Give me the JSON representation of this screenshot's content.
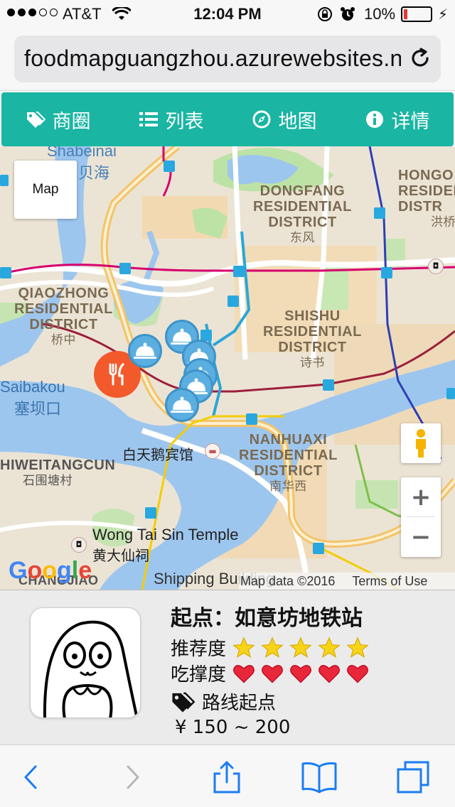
{
  "status": {
    "carrier": "AT&T",
    "time": "12:04 PM",
    "battery": "10%"
  },
  "browser": {
    "url": "foodmapguangzhou.azurewebsites.net"
  },
  "nav": {
    "items": [
      {
        "label": "商圈",
        "icon": "tags-icon"
      },
      {
        "label": "列表",
        "icon": "list-icon"
      },
      {
        "label": "地图",
        "icon": "compass-icon"
      },
      {
        "label": "详情",
        "icon": "info-icon"
      }
    ]
  },
  "map": {
    "type_button": "Map",
    "districts": [
      {
        "name": "DONGFANG\nRESIDENTIAL\nDISTRICT",
        "en1": "DONGFANG",
        "en2": "RESIDENTIAL",
        "en3": "DISTRICT",
        "zh": "东风"
      },
      {
        "en1": "QIAOZHONG",
        "en2": "RESIDENTIAL",
        "en3": "DISTRICT",
        "zh": "桥中"
      },
      {
        "en1": "SHISHU",
        "en2": "RESIDENTIAL",
        "en3": "DISTRICT",
        "zh": "诗书"
      },
      {
        "en1": "NANHUAXI",
        "en2": "RESIDENTIAL",
        "en3": "DISTRICT",
        "zh": "南华西"
      },
      {
        "en1": "HONGO",
        "en2": "RESIDEN",
        "en3": "DISTR",
        "zh": "洪桥"
      }
    ],
    "shabeinai": "Shabeinai",
    "shabeinai_zh": "贝海",
    "saibakou": "Saibakou",
    "saibakou_zh": "塞坝口",
    "shiweitangcun": "HIWEITANGCUN",
    "shiweitangcun_zh": "石围塘村",
    "hotel": "白天鹅宾馆",
    "temple": "Wong Tai Sin Temple",
    "temple_zh": "黄大仙祠",
    "shipping": "Shipping Building",
    "changjiao": "CHANGJIAO",
    "google": "Google",
    "attribution": "Map data ©2016",
    "terms": "Terms of Use"
  },
  "detail": {
    "title": "起点：如意坊地铁站",
    "recommend_label": "推荐度",
    "recommend_stars": 5,
    "filling_label": "吃撑度",
    "filling_hearts": 5,
    "tag": "路线起点",
    "price": "¥ 150 ~ 200"
  },
  "colors": {
    "nav_bg": "#1ab5a3",
    "marker_blue": "#5aaee0",
    "start_marker": "#f25a2c",
    "star": "#f7d417",
    "heart": "#e8273a",
    "ios_blue": "#1a7cf2"
  }
}
